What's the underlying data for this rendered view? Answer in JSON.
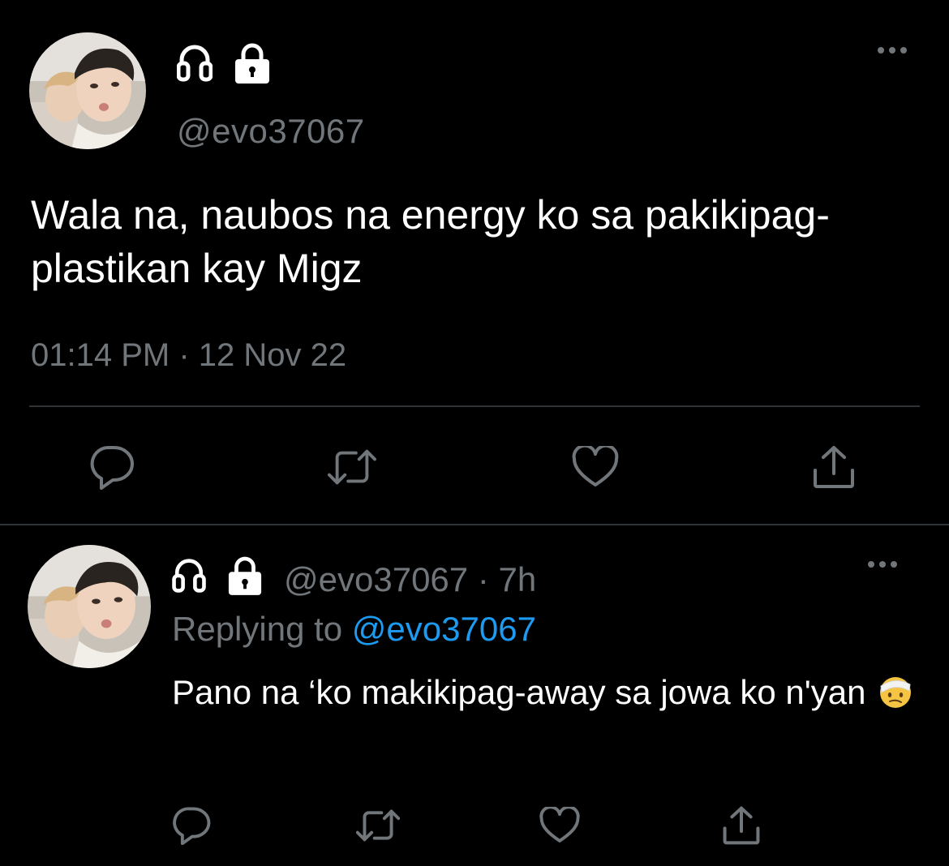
{
  "main_tweet": {
    "handle": "@evo37067",
    "text": "Wala na, naubos na energy ko sa pakikipag-plastikan kay Migz",
    "timestamp": "01:14 PM · 12 Nov 22",
    "icons": [
      "headphones-icon",
      "lock-icon",
      "more-icon"
    ],
    "actions": [
      "reply-icon",
      "retweet-icon",
      "like-icon",
      "share-icon"
    ]
  },
  "reply_tweet": {
    "handle": "@evo37067",
    "separator": " · ",
    "age": "7h",
    "replying_prefix": "Replying to ",
    "replying_to": "@evo37067",
    "text": "Pano na ‘ko makikipag-away sa jowa ko n'yan",
    "emoji": "face-with-head-bandage-emoji",
    "icons": [
      "headphones-icon",
      "lock-icon",
      "more-icon"
    ],
    "actions": [
      "reply-icon",
      "retweet-icon",
      "like-icon",
      "share-icon"
    ]
  },
  "colors": {
    "background": "#000000",
    "text": "#ffffff",
    "secondary": "#71767b",
    "accent": "#1d9bf0",
    "divider": "#2f3336"
  }
}
